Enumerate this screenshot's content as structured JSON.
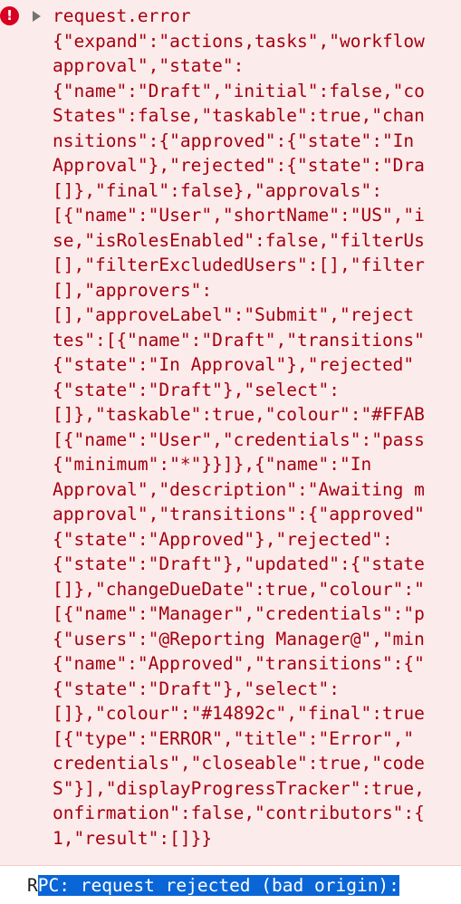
{
  "console_message": {
    "level": "error",
    "icon": "error-icon",
    "title": "request.error",
    "lines": [
      "{\"expand\":\"actions,tasks\",\"workflow",
      "approval\",\"state\":",
      "{\"name\":\"Draft\",\"initial\":false,\"co",
      "States\":false,\"taskable\":true,\"chan",
      "nsitions\":{\"approved\":{\"state\":\"In",
      "Approval\"},\"rejected\":{\"state\":\"Dra",
      "[]},\"final\":false},\"approvals\":",
      "[{\"name\":\"User\",\"shortName\":\"US\",\"i",
      "se,\"isRolesEnabled\":false,\"filterUs",
      "[],\"filterExcludedUsers\":[],\"filter",
      "[],\"approvers\":",
      "[],\"approveLabel\":\"Submit\",\"reject",
      "tes\":[{\"name\":\"Draft\",\"transitions\"",
      "{\"state\":\"In Approval\"},\"rejected\"",
      "{\"state\":\"Draft\"},\"select\":",
      "[]},\"taskable\":true,\"colour\":\"#FFAB",
      "[{\"name\":\"User\",\"credentials\":\"pass",
      "{\"minimum\":\"*\"}}]},{\"name\":\"In",
      "Approval\",\"description\":\"Awaiting m",
      "approval\",\"transitions\":{\"approved\"",
      "{\"state\":\"Approved\"},\"rejected\":",
      "{\"state\":\"Draft\"},\"updated\":{\"state",
      "[]},\"changeDueDate\":true,\"colour\":\"",
      "[{\"name\":\"Manager\",\"credentials\":\"p",
      "{\"users\":\"@Reporting Manager@\",\"min",
      "{\"name\":\"Approved\",\"transitions\":{\"",
      "{\"state\":\"Draft\"},\"select\":",
      "[]},\"colour\":\"#14892c\",\"final\":true",
      "[{\"type\":\"ERROR\",\"title\":\"Error\",\"",
      "credentials\",\"closeable\":true,\"code",
      "S\"}],\"displayProgressTracker\":true,",
      "onfirmation\":false,\"contributors\":{",
      "1,\"result\":[]}}"
    ]
  },
  "next_message": {
    "lead_char": "R",
    "selected_text": "PC: request rejected (bad origin):",
    "tail": " "
  },
  "colors": {
    "error_background": "#fcebeb",
    "error_text": "#a4000f",
    "error_icon": "#d70022",
    "selection": "#0a66d6"
  }
}
